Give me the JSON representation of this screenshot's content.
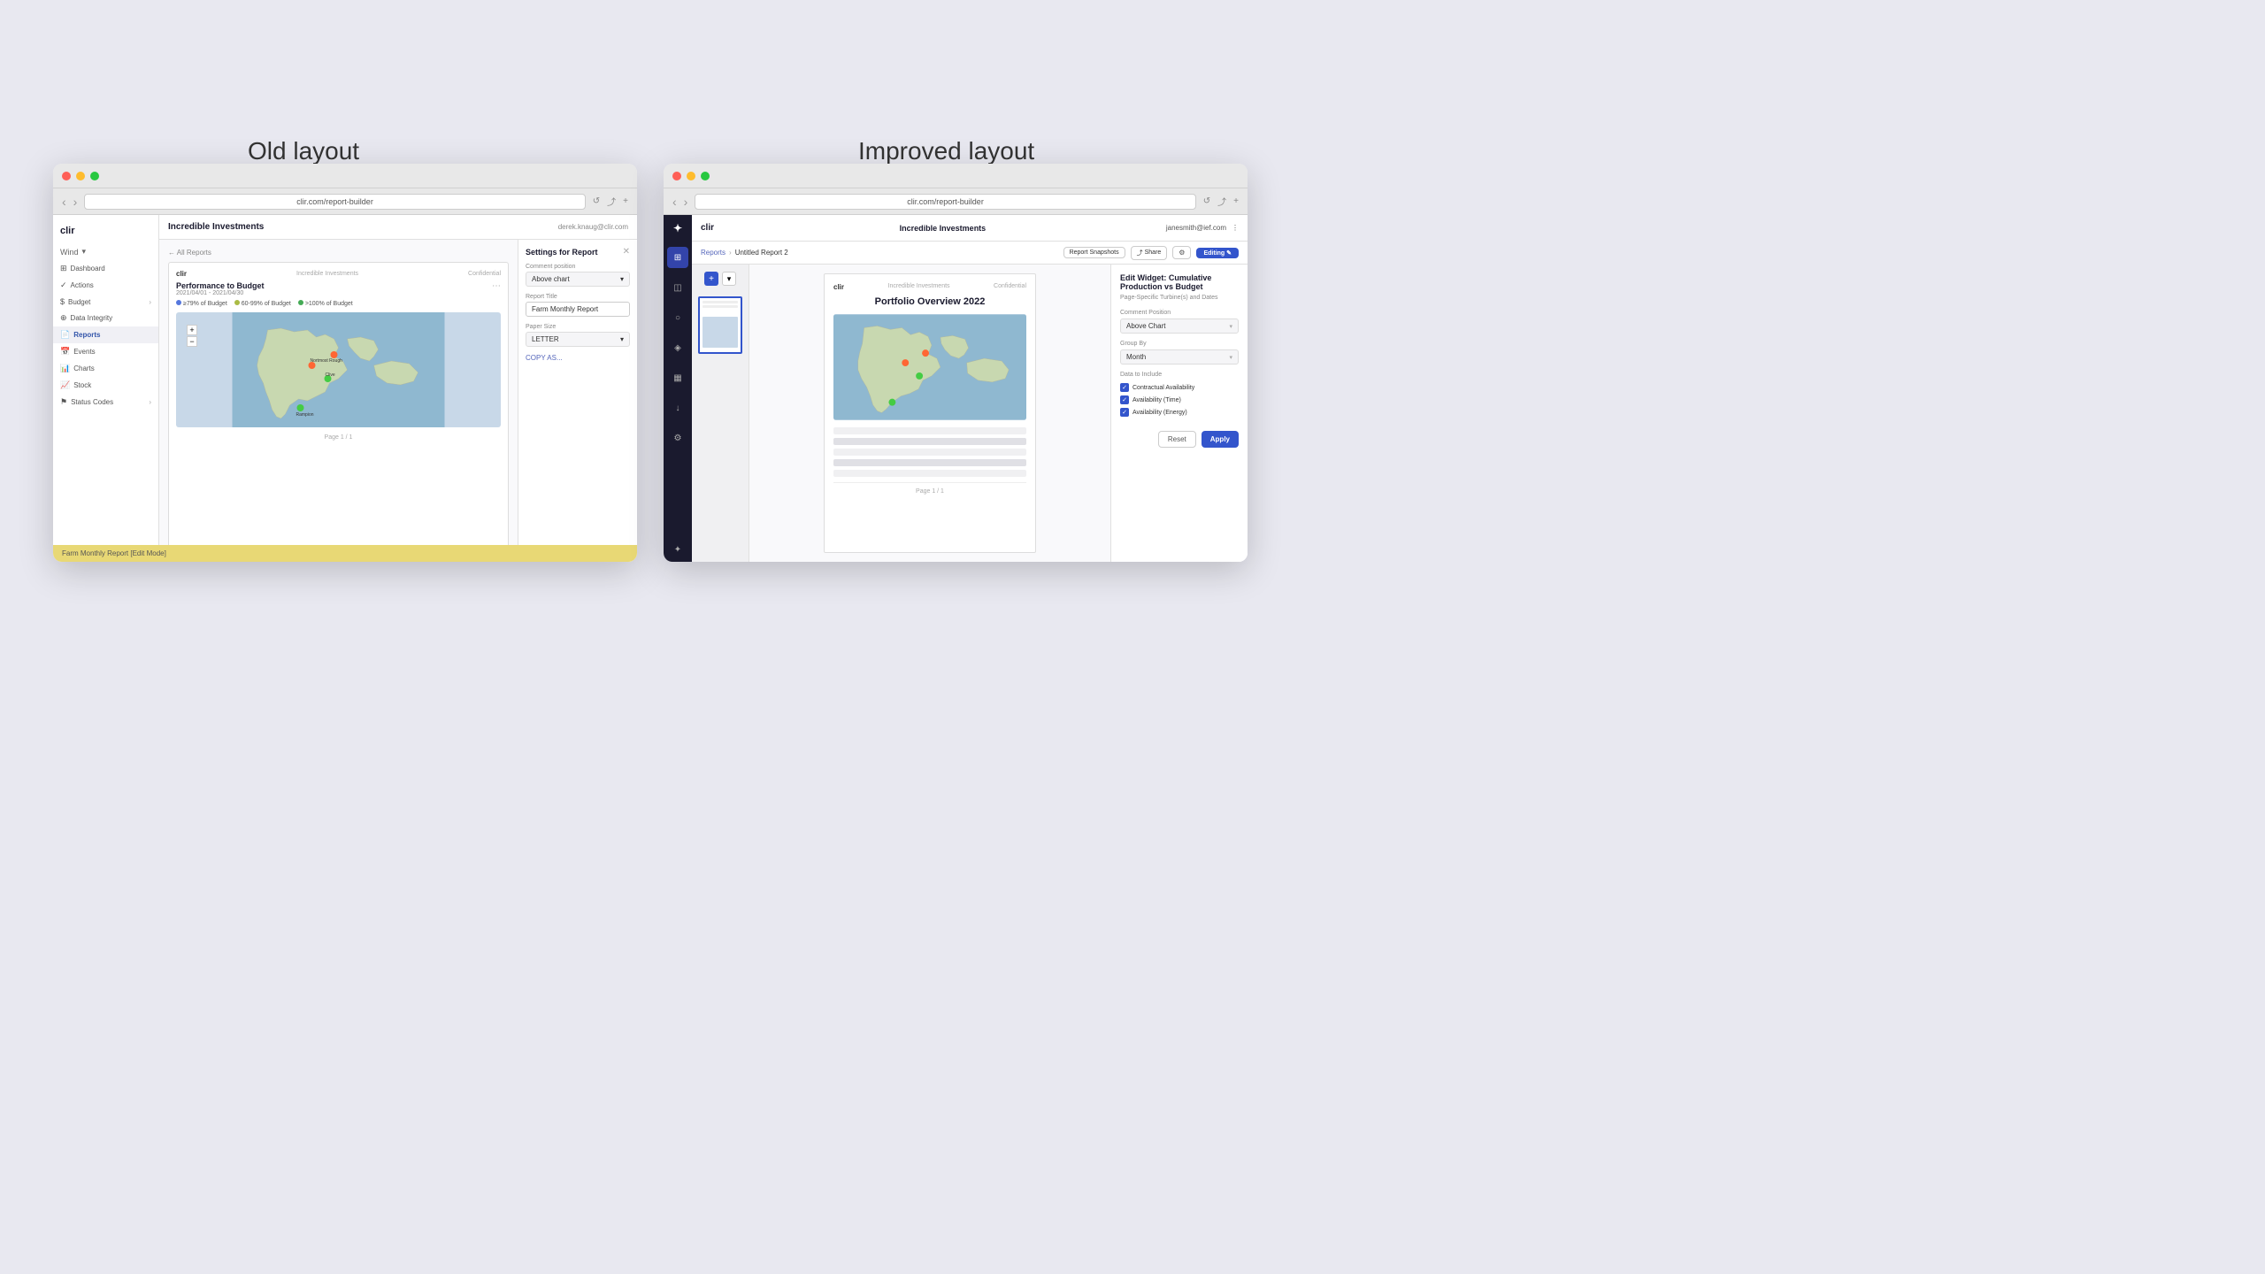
{
  "page": {
    "background": "#e8e8f0",
    "old_label": "Old layout",
    "new_label": "Improved layout"
  },
  "old_window": {
    "url": "clir.com/report-builder",
    "app_name": "clir",
    "company": "Incredible Investments",
    "user_email": "derek.knaug@clir.com",
    "sidebar": {
      "org": "Wind",
      "items": [
        {
          "label": "Dashboard",
          "icon": "⊞",
          "active": false
        },
        {
          "label": "Actions",
          "icon": "✓",
          "active": false
        },
        {
          "label": "Budget",
          "icon": "₿",
          "active": false
        },
        {
          "label": "Data Integrity",
          "icon": "⊕",
          "active": false
        },
        {
          "label": "Reports",
          "icon": "📄",
          "active": true
        },
        {
          "label": "Events",
          "icon": "📅",
          "active": false
        },
        {
          "label": "Charts",
          "icon": "📊",
          "active": false
        },
        {
          "label": "Stock",
          "icon": "📈",
          "active": false
        },
        {
          "label": "Status Codes",
          "icon": "⚑",
          "active": false
        }
      ]
    },
    "breadcrumb": "All Reports",
    "report": {
      "company_logo": "Incredible Investments",
      "title": "Performance to Budget",
      "date_range": "2021/04/01 - 2021/04/30",
      "legend": [
        {
          "label": "≥79% of Budget",
          "color": "#5577dd"
        },
        {
          "label": "60-99% of Budget",
          "color": "#aabb44"
        },
        {
          "label": ">100% of Budget",
          "color": "#44aa55"
        }
      ]
    },
    "settings_panel": {
      "title": "Settings for Report",
      "comment_position_label": "Comment position",
      "comment_position_value": "Above chart",
      "report_title_label": "Report Title",
      "report_title_value": "Farm Monthly Report",
      "paper_size_label": "Paper Size",
      "paper_size_value": "LETTER",
      "copy_as_label": "COPY AS..."
    },
    "footer": "Farm Monthly Report [Edit Mode]"
  },
  "new_window": {
    "url": "clir.com/report-builder",
    "app_name": "clir",
    "company": "Incredible Investments",
    "user_email": "janesmith@ief.com",
    "breadcrumb": {
      "parent": "Reports",
      "separator": "›",
      "current": "Untitled Report 2"
    },
    "toolbar": {
      "snapshots_label": "Report Snapshots",
      "share_label": "Share",
      "gear_label": "⚙",
      "editing_label": "Editing ✎"
    },
    "report_title": "Portfolio Overview 2022",
    "page_footer": "Page 1 / 1",
    "edit_panel": {
      "title": "Edit Widget: Cumulative Production vs Budget",
      "subtitle": "Page-Specific Turbine(s) and Dates",
      "comment_position_label": "Comment Position",
      "comment_position_value": "Above Chart",
      "group_by_label": "Group By",
      "group_by_value": "Month",
      "data_to_include_label": "Data to Include",
      "checkboxes": [
        {
          "label": "Contractual Availability",
          "checked": true
        },
        {
          "label": "Availability (Time)",
          "checked": true
        },
        {
          "label": "Availability (Energy)",
          "checked": true
        }
      ],
      "reset_label": "Reset",
      "apply_label": "Apply"
    }
  }
}
